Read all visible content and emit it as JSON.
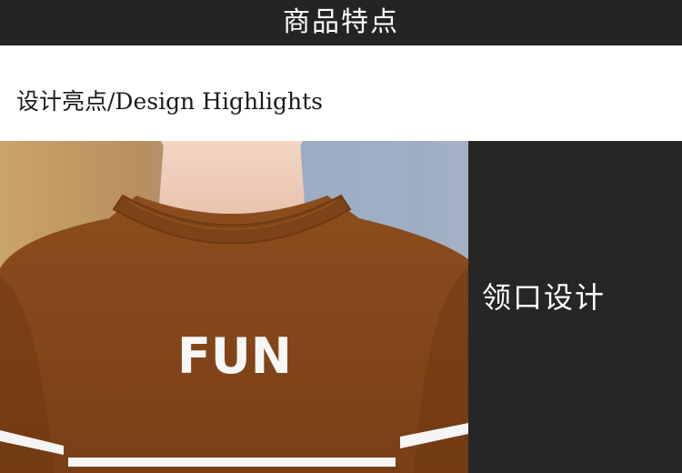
{
  "header": {
    "title": "商品特点"
  },
  "section": {
    "subtitle": "设计亮点/Design Highlights"
  },
  "feature": {
    "label": "领口设计"
  },
  "photo": {
    "sweater_text": "FUN"
  },
  "colors": {
    "header_bg": "#242424",
    "panel_bg": "#262626",
    "sweater": "#8a4a1c"
  }
}
